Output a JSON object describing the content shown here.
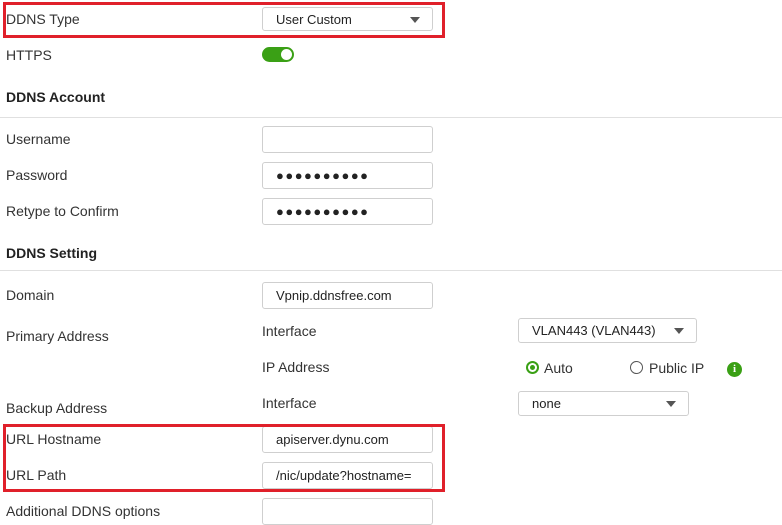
{
  "ddns_type": {
    "label": "DDNS Type",
    "value": "User Custom"
  },
  "https": {
    "label": "HTTPS",
    "enabled": true
  },
  "account": {
    "heading": "DDNS Account",
    "username_label": "Username",
    "username_value": "",
    "password_label": "Password",
    "password_value": "●●●●●●●●●●",
    "retype_label": "Retype to Confirm",
    "retype_value": "●●●●●●●●●●"
  },
  "setting": {
    "heading": "DDNS Setting",
    "domain_label": "Domain",
    "domain_value": "Vpnip.ddnsfree.com",
    "primary_label": "Primary Address",
    "primary_interface_label": "Interface",
    "primary_interface_value": "VLAN443 (VLAN443)",
    "ip_address_label": "IP Address",
    "ip_auto_label": "Auto",
    "ip_public_label": "Public IP",
    "ip_selected": "Auto",
    "info_icon_glyph": "i",
    "backup_label": "Backup Address",
    "backup_interface_label": "Interface",
    "backup_interface_value": "none",
    "url_hostname_label": "URL Hostname",
    "url_hostname_value": "apiserver.dynu.com",
    "url_path_label": "URL Path",
    "url_path_value": "/nic/update?hostname=",
    "additional_label": "Additional DDNS options",
    "additional_value": ""
  },
  "colors": {
    "accent_green": "#3aa015",
    "highlight_red": "#e0202a"
  }
}
